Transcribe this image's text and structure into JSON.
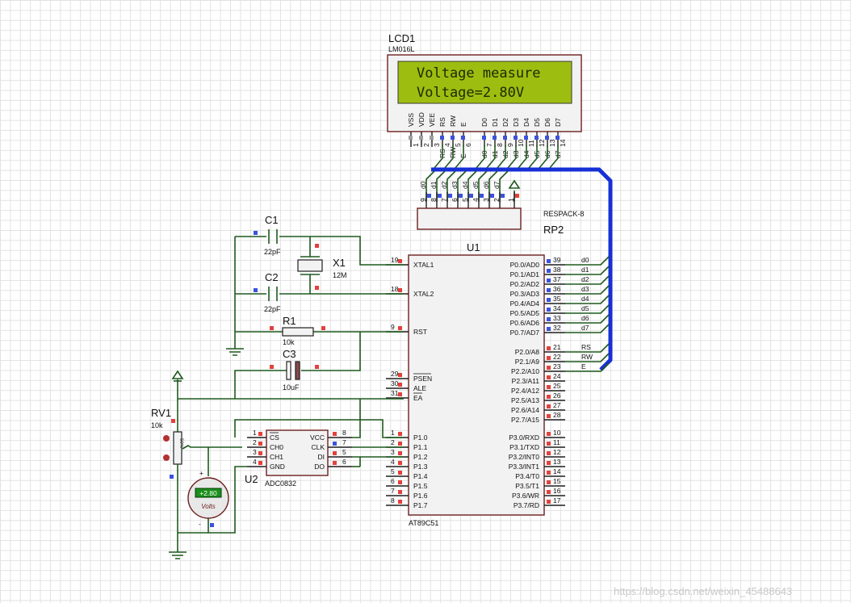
{
  "lcd": {
    "ref": "LCD1",
    "model": "LM016L",
    "line1": "Voltage measure",
    "line2": "Voltage=2.80V",
    "pins": [
      "VSS",
      "VDD",
      "VEE",
      "RS",
      "RW",
      "E",
      "D0",
      "D1",
      "D2",
      "D3",
      "D4",
      "D5",
      "D6",
      "D7"
    ],
    "pin_numbers": [
      "1",
      "2",
      "3",
      "4",
      "5",
      "6",
      "7",
      "8",
      "9",
      "10",
      "11",
      "12",
      "13",
      "14"
    ],
    "net_labels": [
      "RS",
      "RW",
      "E",
      "d0",
      "d1",
      "d2",
      "d3",
      "d4",
      "d5",
      "d6",
      "d7"
    ]
  },
  "rp2": {
    "ref": "RP2",
    "model": "RESPACK-8",
    "pins": [
      "9",
      "8",
      "7",
      "6",
      "5",
      "4",
      "3",
      "2",
      "1"
    ],
    "net_labels": [
      "d0",
      "d1",
      "d2",
      "d3",
      "d4",
      "d5",
      "d6",
      "d7"
    ]
  },
  "u1": {
    "ref": "U1",
    "model": "AT89C51",
    "left_pins": [
      {
        "num": "19",
        "name": "XTAL1"
      },
      {
        "num": "18",
        "name": "XTAL2"
      },
      {
        "num": "9",
        "name": "RST"
      },
      {
        "num": "29",
        "name": "PSEN"
      },
      {
        "num": "30",
        "name": "ALE"
      },
      {
        "num": "31",
        "name": "EA"
      },
      {
        "num": "1",
        "name": "P1.0"
      },
      {
        "num": "2",
        "name": "P1.1"
      },
      {
        "num": "3",
        "name": "P1.2"
      },
      {
        "num": "4",
        "name": "P1.3"
      },
      {
        "num": "5",
        "name": "P1.4"
      },
      {
        "num": "6",
        "name": "P1.5"
      },
      {
        "num": "7",
        "name": "P1.6"
      },
      {
        "num": "8",
        "name": "P1.7"
      }
    ],
    "right_pins": [
      {
        "num": "39",
        "name": "P0.0/AD0",
        "net": "d0"
      },
      {
        "num": "38",
        "name": "P0.1/AD1",
        "net": "d1"
      },
      {
        "num": "37",
        "name": "P0.2/AD2",
        "net": "d2"
      },
      {
        "num": "36",
        "name": "P0.3/AD3",
        "net": "d3"
      },
      {
        "num": "35",
        "name": "P0.4/AD4",
        "net": "d4"
      },
      {
        "num": "34",
        "name": "P0.5/AD5",
        "net": "d5"
      },
      {
        "num": "33",
        "name": "P0.6/AD6",
        "net": "d6"
      },
      {
        "num": "32",
        "name": "P0.7/AD7",
        "net": "d7"
      },
      {
        "num": "21",
        "name": "P2.0/A8",
        "net": "RS"
      },
      {
        "num": "22",
        "name": "P2.1/A9",
        "net": "RW"
      },
      {
        "num": "23",
        "name": "P2.2/A10",
        "net": "E"
      },
      {
        "num": "24",
        "name": "P2.3/A11",
        "net": ""
      },
      {
        "num": "25",
        "name": "P2.4/A12",
        "net": ""
      },
      {
        "num": "26",
        "name": "P2.5/A13",
        "net": ""
      },
      {
        "num": "27",
        "name": "P2.6/A14",
        "net": ""
      },
      {
        "num": "28",
        "name": "P2.7/A15",
        "net": ""
      },
      {
        "num": "10",
        "name": "P3.0/RXD",
        "net": ""
      },
      {
        "num": "11",
        "name": "P3.1/TXD",
        "net": ""
      },
      {
        "num": "12",
        "name": "P3.2/INT0",
        "net": ""
      },
      {
        "num": "13",
        "name": "P3.3/INT1",
        "net": ""
      },
      {
        "num": "14",
        "name": "P3.4/T0",
        "net": ""
      },
      {
        "num": "15",
        "name": "P3.5/T1",
        "net": ""
      },
      {
        "num": "16",
        "name": "P3.6/WR",
        "net": ""
      },
      {
        "num": "17",
        "name": "P3.7/RD",
        "net": ""
      }
    ]
  },
  "u2": {
    "ref": "U2",
    "model": "ADC0832",
    "left_pins": [
      {
        "num": "1",
        "name": "CS"
      },
      {
        "num": "2",
        "name": "CH0"
      },
      {
        "num": "3",
        "name": "CH1"
      },
      {
        "num": "4",
        "name": "GND"
      }
    ],
    "right_pins": [
      {
        "num": "8",
        "name": "VCC"
      },
      {
        "num": "7",
        "name": "CLK"
      },
      {
        "num": "5",
        "name": "DI"
      },
      {
        "num": "6",
        "name": "DO"
      }
    ]
  },
  "c1": {
    "ref": "C1",
    "value": "22pF"
  },
  "c2": {
    "ref": "C2",
    "value": "22pF"
  },
  "c3": {
    "ref": "C3",
    "value": "10uF"
  },
  "x1": {
    "ref": "X1",
    "value": "12M"
  },
  "r1": {
    "ref": "R1",
    "value": "10k"
  },
  "rv1": {
    "ref": "RV1",
    "value": "10k",
    "percent": "50%"
  },
  "voltmeter": {
    "reading": "+2.80",
    "unit": "Volts",
    "plus": "+",
    "minus": "-"
  },
  "watermark": "https://blog.csdn.net/weixin_45488643",
  "colors": {
    "wire": "#1f5a1f",
    "bus": "#1730d6",
    "lcd_screen": "#9dbd10",
    "pin_red": "#e2413c",
    "pin_blue": "#3a52dc"
  }
}
